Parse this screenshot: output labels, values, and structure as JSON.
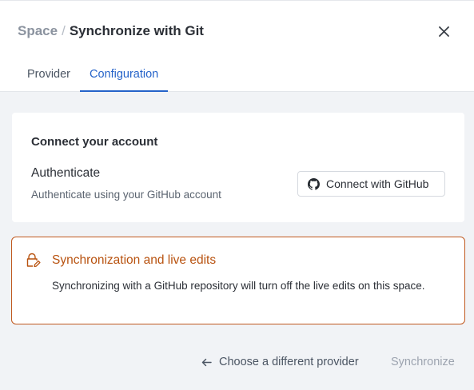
{
  "header": {
    "breadcrumb_parent": "Space",
    "breadcrumb_separator": "/",
    "title": "Synchronize with Git",
    "close_icon": "close-icon"
  },
  "tabs": [
    {
      "label": "Provider",
      "active": false
    },
    {
      "label": "Configuration",
      "active": true
    }
  ],
  "card": {
    "heading": "Connect your account",
    "auth_title": "Authenticate",
    "auth_description": "Authenticate using your GitHub account",
    "button_label": "Connect with GitHub",
    "button_icon": "github-icon"
  },
  "warning": {
    "icon": "lock-edit-icon",
    "title": "Synchronization and live edits",
    "text": "Synchronizing with a GitHub repository will turn off the live edits on this space.",
    "accent_color": "#c0591f"
  },
  "footer": {
    "back_icon": "arrow-left-icon",
    "back_label": "Choose a different provider",
    "sync_label": "Synchronize"
  },
  "colors": {
    "active_tab": "#2563c9",
    "background": "#f1f3f6"
  }
}
